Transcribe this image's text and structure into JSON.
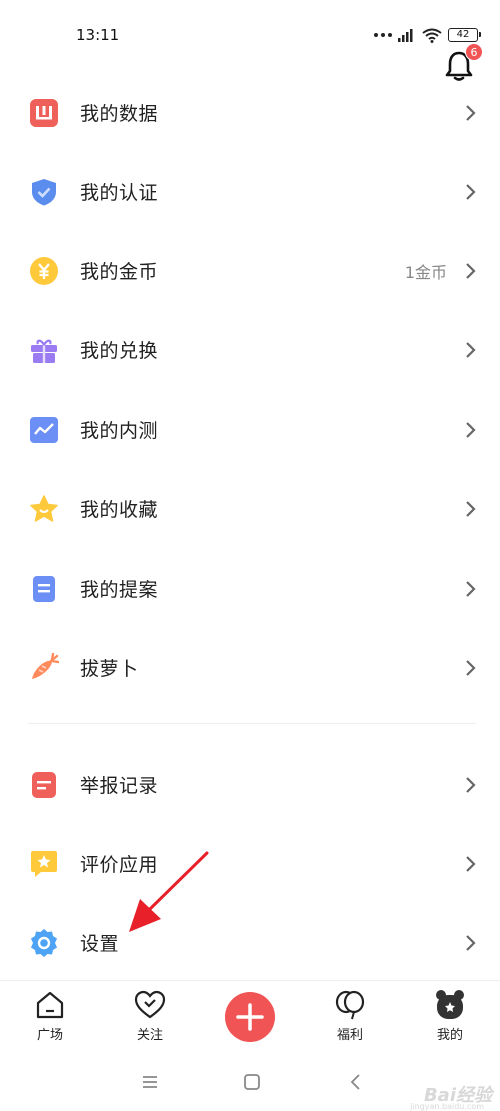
{
  "status_bar": {
    "time": "13:11",
    "battery": "42"
  },
  "header": {
    "notification_count": "6"
  },
  "menu": {
    "items": [
      {
        "label": "我的数据",
        "value": "",
        "icon": "data-chart-icon",
        "color": "#f0605a"
      },
      {
        "label": "我的认证",
        "value": "",
        "icon": "shield-check-icon",
        "color": "#5b8def"
      },
      {
        "label": "我的金币",
        "value": "1金币",
        "icon": "yuan-coin-icon",
        "color": "#ffc93c"
      },
      {
        "label": "我的兑换",
        "value": "",
        "icon": "gift-icon",
        "color": "#9b7bf2"
      },
      {
        "label": "我的内测",
        "value": "",
        "icon": "line-chart-icon",
        "color": "#6b8ff5"
      },
      {
        "label": "我的收藏",
        "value": "",
        "icon": "star-icon",
        "color": "#ffc93c"
      },
      {
        "label": "我的提案",
        "value": "",
        "icon": "document-icon",
        "color": "#6b8ff5"
      },
      {
        "label": "拔萝卜",
        "value": "",
        "icon": "carrot-icon",
        "color": "#ff8a5b"
      }
    ],
    "secondary_items": [
      {
        "label": "举报记录",
        "value": "",
        "icon": "report-icon",
        "color": "#f0605a"
      },
      {
        "label": "评价应用",
        "value": "",
        "icon": "rate-star-icon",
        "color": "#ffc93c"
      },
      {
        "label": "设置",
        "value": "",
        "icon": "gear-icon",
        "color": "#4ea3f5"
      }
    ]
  },
  "bottom_nav": {
    "items": [
      {
        "label": "广场",
        "icon": "home-icon"
      },
      {
        "label": "关注",
        "icon": "heart-icon"
      },
      {
        "label": "",
        "icon": "plus-icon"
      },
      {
        "label": "福利",
        "icon": "balloon-icon"
      },
      {
        "label": "我的",
        "icon": "bear-icon"
      }
    ]
  },
  "watermark": {
    "text": "Bai经验",
    "sub": "jingyan.baidu.com"
  },
  "colors": {
    "accent": "#f05454",
    "annotation_arrow": "#e8202a"
  }
}
